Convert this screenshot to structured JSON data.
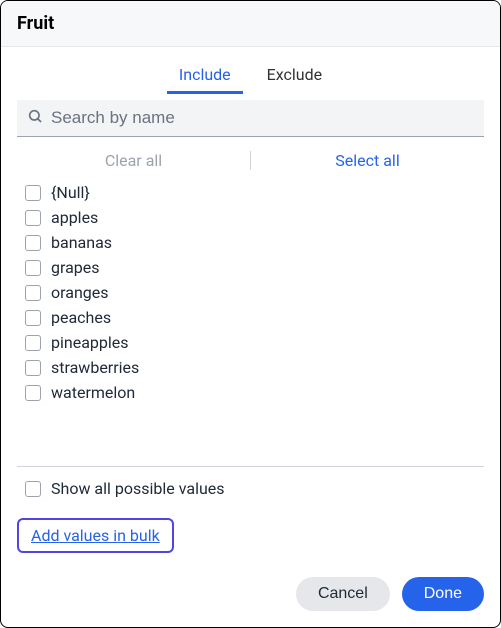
{
  "header": {
    "title": "Fruit"
  },
  "tabs": {
    "include": "Include",
    "exclude": "Exclude"
  },
  "search": {
    "placeholder": "Search by name"
  },
  "actions": {
    "clear_all": "Clear all",
    "select_all": "Select all"
  },
  "items": [
    "{Null}",
    "apples",
    "bananas",
    "grapes",
    "oranges",
    "peaches",
    "pineapples",
    "strawberries",
    "watermelon"
  ],
  "show_all": {
    "label": "Show all possible values"
  },
  "bulk": {
    "label": "Add values in bulk"
  },
  "footer": {
    "cancel": "Cancel",
    "done": "Done"
  }
}
